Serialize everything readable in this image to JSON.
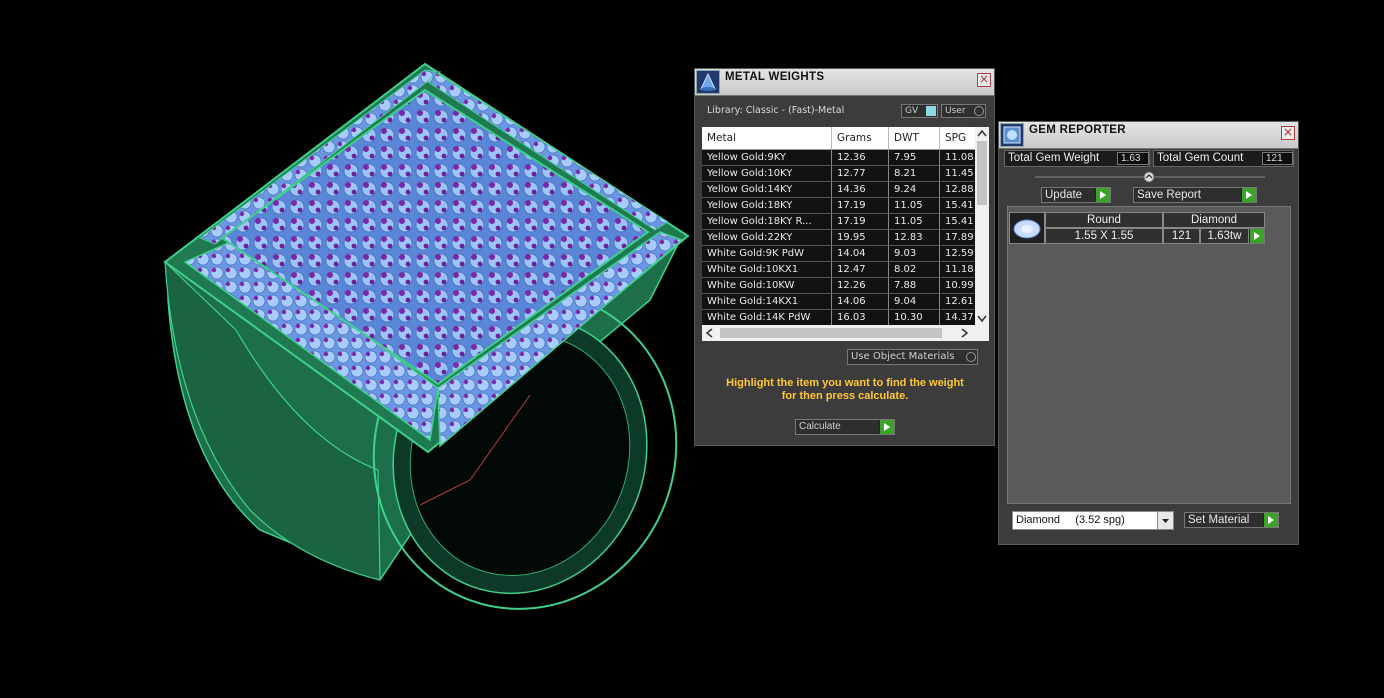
{
  "metal_weights": {
    "title": "METAL WEIGHTS",
    "library_label": "Library: Classic - (Fast)-Metal",
    "toggle_gv": "GV",
    "toggle_user": "User",
    "columns": [
      "Metal",
      "Grams",
      "DWT",
      "SPG"
    ],
    "rows": [
      {
        "metal": "Yellow Gold:9KY",
        "grams": "12.36",
        "dwt": "7.95",
        "spg": "11.08"
      },
      {
        "metal": "Yellow Gold:10KY",
        "grams": "12.77",
        "dwt": "8.21",
        "spg": "11.45"
      },
      {
        "metal": "Yellow Gold:14KY",
        "grams": "14.36",
        "dwt": "9.24",
        "spg": "12.88"
      },
      {
        "metal": "Yellow Gold:18KY",
        "grams": "17.19",
        "dwt": "11.05",
        "spg": "15.41"
      },
      {
        "metal": "Yellow Gold:18KY R...",
        "grams": "17.19",
        "dwt": "11.05",
        "spg": "15.41"
      },
      {
        "metal": "Yellow Gold:22KY",
        "grams": "19.95",
        "dwt": "12.83",
        "spg": "17.89"
      },
      {
        "metal": "White Gold:9K PdW",
        "grams": "14.04",
        "dwt": "9.03",
        "spg": "12.59"
      },
      {
        "metal": "White Gold:10KX1",
        "grams": "12.47",
        "dwt": "8.02",
        "spg": "11.18"
      },
      {
        "metal": "White Gold:10KW",
        "grams": "12.26",
        "dwt": "7.88",
        "spg": "10.99"
      },
      {
        "metal": "White Gold:14KX1",
        "grams": "14.06",
        "dwt": "9.04",
        "spg": "12.61"
      },
      {
        "metal": "White Gold:14K PdW",
        "grams": "16.03",
        "dwt": "10.30",
        "spg": "14.37"
      }
    ],
    "use_object_materials": "Use Object Materials",
    "hint_line1": "Highlight the item you want to find the weight",
    "hint_line2": "for then press calculate.",
    "calculate_label": "Calculate"
  },
  "gem_reporter": {
    "title": "GEM REPORTER",
    "total_weight_label": "Total Gem Weight",
    "total_weight_value": "1.63",
    "total_count_label": "Total Gem Count",
    "total_count_value": "121",
    "update_label": "Update",
    "save_report_label": "Save Report",
    "gem_row": {
      "shape": "Round",
      "material": "Diamond",
      "size": "1.55 X 1.55",
      "count": "121",
      "weight": "1.63tw"
    },
    "material_select": "Diamond     (3.52 spg)",
    "set_material_label": "Set Material"
  },
  "colors": {
    "ring_green": "#1f7a52",
    "ring_edge": "#3fd68c",
    "gem_blue": "#8ab8ff",
    "gem_purple": "#7a2aa8",
    "panel_bg": "#3c3c3c",
    "hint_yellow": "#ffc83a",
    "button_green": "#3da22a"
  }
}
